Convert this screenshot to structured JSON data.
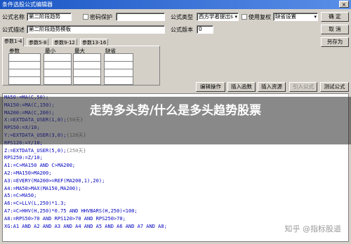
{
  "window": {
    "title": "条件选股公式编辑器",
    "close_label": "×"
  },
  "form": {
    "name_label": "公式名称",
    "name_value": "第二阶段趋势",
    "password_label": "密码保护",
    "desc_label": "公式描述",
    "desc_value": "第二阶段趋势模板",
    "type_label": "公式类型",
    "type_value": "西方学者提出s",
    "period_label": "使用复权",
    "period_value": "缺省设置",
    "version_label": "公式版本",
    "version_value": "0"
  },
  "buttons": {
    "ok": "确 定",
    "cancel": "取 消",
    "save_as": "另存为",
    "edit_ops": "编辑操作",
    "insert_func": "插入函数",
    "insert_resource": "插入资源",
    "import_formula": "引入公式",
    "test_formula": "测试公式"
  },
  "tabs": [
    "参数1-4",
    "参数5-8",
    "参数9-12",
    "参数13-16"
  ],
  "param_headers": [
    "参数",
    "最小",
    "最大",
    "缺省"
  ],
  "code_lines": [
    [
      {
        "t": "MA50:=MA(C,50);",
        "c": "blue"
      }
    ],
    [
      {
        "t": "MA150:=MA(C,150);",
        "c": "blue"
      }
    ],
    [
      {
        "t": "MA200:=MA(C,200);",
        "c": "blue"
      }
    ],
    [
      {
        "t": "X:=EXTDATA_USER(1,0);",
        "c": "blue"
      },
      {
        "t": "{50天}",
        "c": "gray"
      }
    ],
    [
      {
        "t": "RPS50:=X/10;",
        "c": "blue"
      }
    ],
    [
      {
        "t": "Y:=EXTDATA_USER(3,0);",
        "c": "blue"
      },
      {
        "t": "{120天}",
        "c": "gray"
      }
    ],
    [
      {
        "t": "RPS120:=Y/10;",
        "c": "blue"
      }
    ],
    [
      {
        "t": "Z:=EXTDATA_USER(5,0);",
        "c": "blue"
      },
      {
        "t": "{250天}",
        "c": "gray"
      }
    ],
    [
      {
        "t": "RPS250:=Z/10;",
        "c": "blue"
      }
    ],
    [
      {
        "t": "A1:=C>MA150 AND C>MA200;",
        "c": "blue"
      }
    ],
    [
      {
        "t": "A2:=MA150>MA200;",
        "c": "blue"
      }
    ],
    [
      {
        "t": "A3:=EVERY(MA200>=REF(MA200,1),20);",
        "c": "blue"
      }
    ],
    [
      {
        "t": "A4:=MA50>MAX(MA150,MA200);",
        "c": "blue"
      }
    ],
    [
      {
        "t": "A5:=C>MA50;",
        "c": "blue"
      }
    ],
    [
      {
        "t": "A6:=C>LLV(L,250)*1.3;",
        "c": "blue"
      }
    ],
    [
      {
        "t": "A7:=C>HHV(H,250)*0.75 AND HHVBARS(H,250)<100;",
        "c": "blue"
      }
    ],
    [
      {
        "t": "A8:=RPS50>70 AND RPS120>70 AND RPS250>70;",
        "c": "blue"
      }
    ],
    [
      {
        "t": "XG:A1 AND A2 AND A3 AND A4 AND A5 AND A6 AND A7 AND A8;",
        "c": "blue"
      }
    ]
  ],
  "overlay": {
    "headline": "走势多头势/什么是多头趋势股票"
  },
  "watermark": "知乎 @指标股道"
}
